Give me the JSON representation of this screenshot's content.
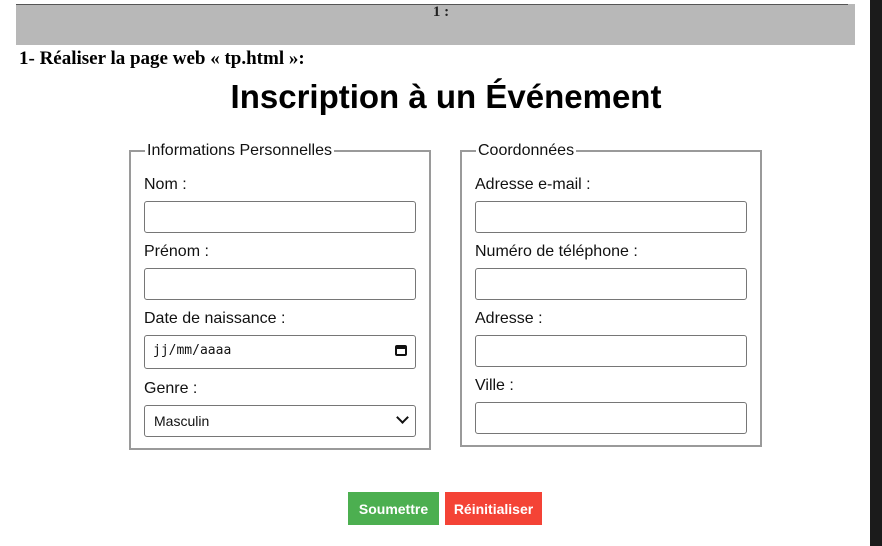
{
  "header": {
    "mark": "1 :"
  },
  "step_text": "1- Réaliser la page web « tp.html »:",
  "form": {
    "title": "Inscription à un Événement",
    "personal": {
      "legend": "Informations Personnelles",
      "nom_label": "Nom :",
      "prenom_label": "Prénom :",
      "dob_label": "Date de naissance :",
      "dob_placeholder": "jj/mm/aaaa",
      "genre_label": "Genre :",
      "genre_value": "Masculin"
    },
    "contact": {
      "legend": "Coordonnées",
      "email_label": "Adresse e-mail :",
      "phone_label": "Numéro de téléphone :",
      "address_label": "Adresse :",
      "city_label": "Ville :"
    },
    "submit_label": "Soumettre",
    "reset_label": "Réinitialiser"
  },
  "colors": {
    "submit": "#4caf50",
    "reset": "#f44336",
    "header_band": "#b8b8b8"
  }
}
